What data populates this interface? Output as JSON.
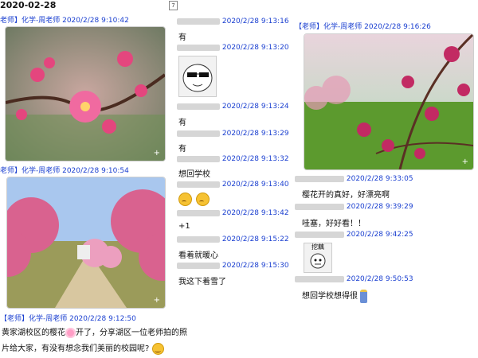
{
  "header": {
    "date": "2020-02-28",
    "calendar_day": "7"
  },
  "left": {
    "msg1": {
      "meta": "老师】化学-周老师 2020/2/28 9:10:42"
    },
    "msg2": {
      "meta": "老师】化学-周老师 2020/2/28 9:10:54"
    },
    "msg3": {
      "meta": "【老师】化学-周老师 2020/2/28 9:12:50",
      "line1": "黄家湖校区的樱花",
      "line1b": "开了，分享湖区一位老师拍的照",
      "line2": "片给大家，有没有想念我们美丽的校园呢?"
    }
  },
  "middle": {
    "items": [
      {
        "time": "2020/2/28 9:13:16",
        "text": "有"
      },
      {
        "time": "2020/2/28 9:13:20",
        "text": ""
      },
      {
        "time": "2020/2/28 9:13:24",
        "text": "有"
      },
      {
        "time": "2020/2/28 9:13:29",
        "text": "有"
      },
      {
        "time": "2020/2/28 9:13:32",
        "text": "想回学校"
      },
      {
        "time": "2020/2/28 9:13:40",
        "text": ""
      },
      {
        "time": "2020/2/28 9:13:42",
        "text": "+1"
      },
      {
        "time": "2020/2/28 9:15:22",
        "text": "看着就暖心"
      },
      {
        "time": "2020/2/28 9:15:30",
        "text": "我这下着雪了"
      }
    ]
  },
  "right": {
    "teacher_meta": "【老师】化学-周老师 2020/2/28 9:16:26",
    "items": [
      {
        "time": "2020/2/28 9:33:05",
        "text": "樱花开的真好，好漂亮啊"
      },
      {
        "time": "2020/2/28 9:39:29",
        "text": "哇塞，好好看！！"
      },
      {
        "time": "2020/2/28 9:42:25",
        "text": ""
      },
      {
        "time": "2020/2/28 9:50:53",
        "text": "想回学校想得很"
      }
    ],
    "sticker_text": "挖藕"
  },
  "colors": {
    "meta_blue": "#1a3fd0"
  }
}
